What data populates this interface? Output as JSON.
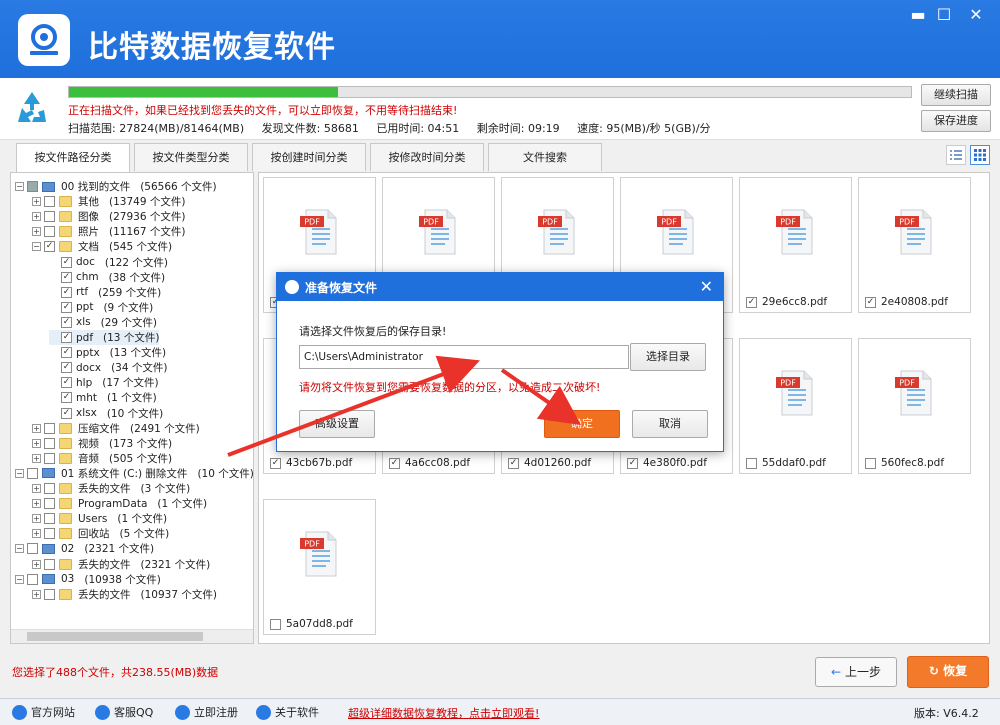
{
  "app": {
    "title": "比特数据恢复软件"
  },
  "window": {
    "minimize": "▬",
    "maximize": "☐",
    "close": "✕"
  },
  "scan": {
    "progress": 0.32,
    "message": "正在扫描文件，如果已经找到您丢失的文件，可以立即恢复，不用等待扫描结束!",
    "range": "扫描范围: 27824(MB)/81464(MB)",
    "found": "发现文件数: 58681",
    "elapsed": "已用时间: 04:51",
    "remaining": "剩余时间: 09:19",
    "speed": "速度: 95(MB)/秒  5(GB)/分",
    "continue_label": "继续扫描",
    "save_progress_label": "保存进度"
  },
  "tabs": [
    "按文件路径分类",
    "按文件类型分类",
    "按创建时间分类",
    "按修改时间分类",
    "文件搜索"
  ],
  "tree": [
    {
      "name": "00 找到的文件",
      "count": "(56566 个文件)"
    },
    {
      "name": "其他",
      "count": "(13749 个文件)"
    },
    {
      "name": "图像",
      "count": "(27936 个文件)"
    },
    {
      "name": "照片",
      "count": "(11167 个文件)"
    },
    {
      "name": "文档",
      "count": "(545 个文件)"
    },
    {
      "name": "doc",
      "count": "(122 个文件)"
    },
    {
      "name": "chm",
      "count": "(38 个文件)"
    },
    {
      "name": "rtf",
      "count": "(259 个文件)"
    },
    {
      "name": "ppt",
      "count": "(9 个文件)"
    },
    {
      "name": "xls",
      "count": "(29 个文件)"
    },
    {
      "name": "pdf",
      "count": "(13 个文件)"
    },
    {
      "name": "pptx",
      "count": "(13 个文件)"
    },
    {
      "name": "docx",
      "count": "(34 个文件)"
    },
    {
      "name": "hlp",
      "count": "(17 个文件)"
    },
    {
      "name": "mht",
      "count": "(1 个文件)"
    },
    {
      "name": "xlsx",
      "count": "(10 个文件)"
    },
    {
      "name": "压缩文件",
      "count": "(2491 个文件)"
    },
    {
      "name": "视频",
      "count": "(173 个文件)"
    },
    {
      "name": "音频",
      "count": "(505 个文件)"
    },
    {
      "name": "01 系统文件 (C:) 删除文件",
      "count": "(10 个文件)"
    },
    {
      "name": "丢失的文件",
      "count": "(3 个文件)"
    },
    {
      "name": "ProgramData",
      "count": "(1 个文件)"
    },
    {
      "name": "Users",
      "count": "(1 个文件)"
    },
    {
      "name": "回收站",
      "count": "(5 个文件)"
    },
    {
      "name": "02",
      "count": "(2321 个文件)"
    },
    {
      "name": "丢失的文件",
      "count": "(2321 个文件)"
    },
    {
      "name": "03",
      "count": "(10938 个文件)"
    },
    {
      "name": "丢失的文件",
      "count": "(10937 个文件)"
    }
  ],
  "files": [
    {
      "name": "",
      "checked": true
    },
    {
      "name": "",
      "checked": true
    },
    {
      "name": "",
      "checked": true
    },
    {
      "name": "",
      "checked": true
    },
    {
      "name": "29e6cc8.pdf",
      "checked": true
    },
    {
      "name": "2e40808.pdf",
      "checked": true
    },
    {
      "name": "43cb67b.pdf",
      "checked": true
    },
    {
      "name": "4a6cc08.pdf",
      "checked": true
    },
    {
      "name": "4d01260.pdf",
      "checked": true
    },
    {
      "name": "4e380f0.pdf",
      "checked": true
    },
    {
      "name": "55ddaf0.pdf",
      "checked": false
    },
    {
      "name": "560fec8.pdf",
      "checked": false
    },
    {
      "name": "5a07dd8.pdf",
      "checked": false
    }
  ],
  "pdf_badge": "PDF",
  "dialog": {
    "title": "准备恢复文件",
    "prompt": "请选择文件恢复后的保存目录!",
    "path": "C:\\Users\\Administrator",
    "browse_label": "选择目录",
    "warning": "请勿将文件恢复到您需要恢复数据的分区，以免造成二次破坏!",
    "advanced_label": "高级设置",
    "ok_label": "确定",
    "cancel_label": "取消"
  },
  "selection": {
    "info": "您选择了488个文件，共238.55(MB)数据"
  },
  "nav": {
    "prev_label": "上一步",
    "recover_label": "恢复"
  },
  "footer": {
    "website": "官方网站",
    "qq": "客服QQ",
    "register": "立即注册",
    "about": "关于软件",
    "tutorial_link": "超级详细数据恢复教程，点击立即观看!",
    "version": "版本: V6.4.2"
  },
  "colors": {
    "titlebar": "#1f6fdc",
    "accent_orange": "#f07020",
    "warning_red": "#d00000",
    "progress_green": "#3cbf3c"
  }
}
